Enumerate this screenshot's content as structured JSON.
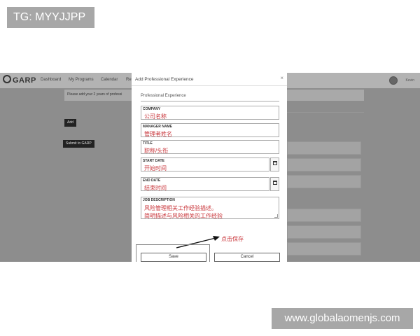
{
  "watermarks": {
    "top_left": "TG: MYYJJPP",
    "bottom_right": "www.globalaomenjs.com"
  },
  "app": {
    "logo_text": "GARP",
    "nav": [
      "Dashboard",
      "My Programs",
      "Calendar",
      "Re"
    ],
    "user_name": "Kevin"
  },
  "background": {
    "banner_text": "Please add your 2 years of professi",
    "add_button": "Add",
    "submit_button": "Submit to GARP"
  },
  "modal": {
    "title": "Add Professional Experience",
    "close_glyph": "×",
    "section": "Professional Experience",
    "fields": {
      "company": {
        "label": "COMPANY",
        "value": "公司名称"
      },
      "manager": {
        "label": "MANAGER NAME",
        "value": "管理者姓名"
      },
      "title": {
        "label": "TITLE",
        "value": "职称/头衔"
      },
      "start_date": {
        "label": "START DATE",
        "value": "开始时间"
      },
      "end_date": {
        "label": "END DATE",
        "value": "结束时间"
      },
      "job_description": {
        "label": "JOB DESCRIPTION",
        "lines": [
          "风险管理相关工作经验描述。",
          "简明描述与风险相关的工作经验"
        ]
      }
    },
    "annotation": "点击保存",
    "save_button": "Save",
    "cancel_button": "Cancel"
  },
  "icons": {
    "calendar": "calendar-icon",
    "close": "close-icon",
    "user": "user-avatar-icon"
  },
  "colors": {
    "annotation_red": "#c9363b",
    "overlay_gray": "#8d8d8d"
  }
}
